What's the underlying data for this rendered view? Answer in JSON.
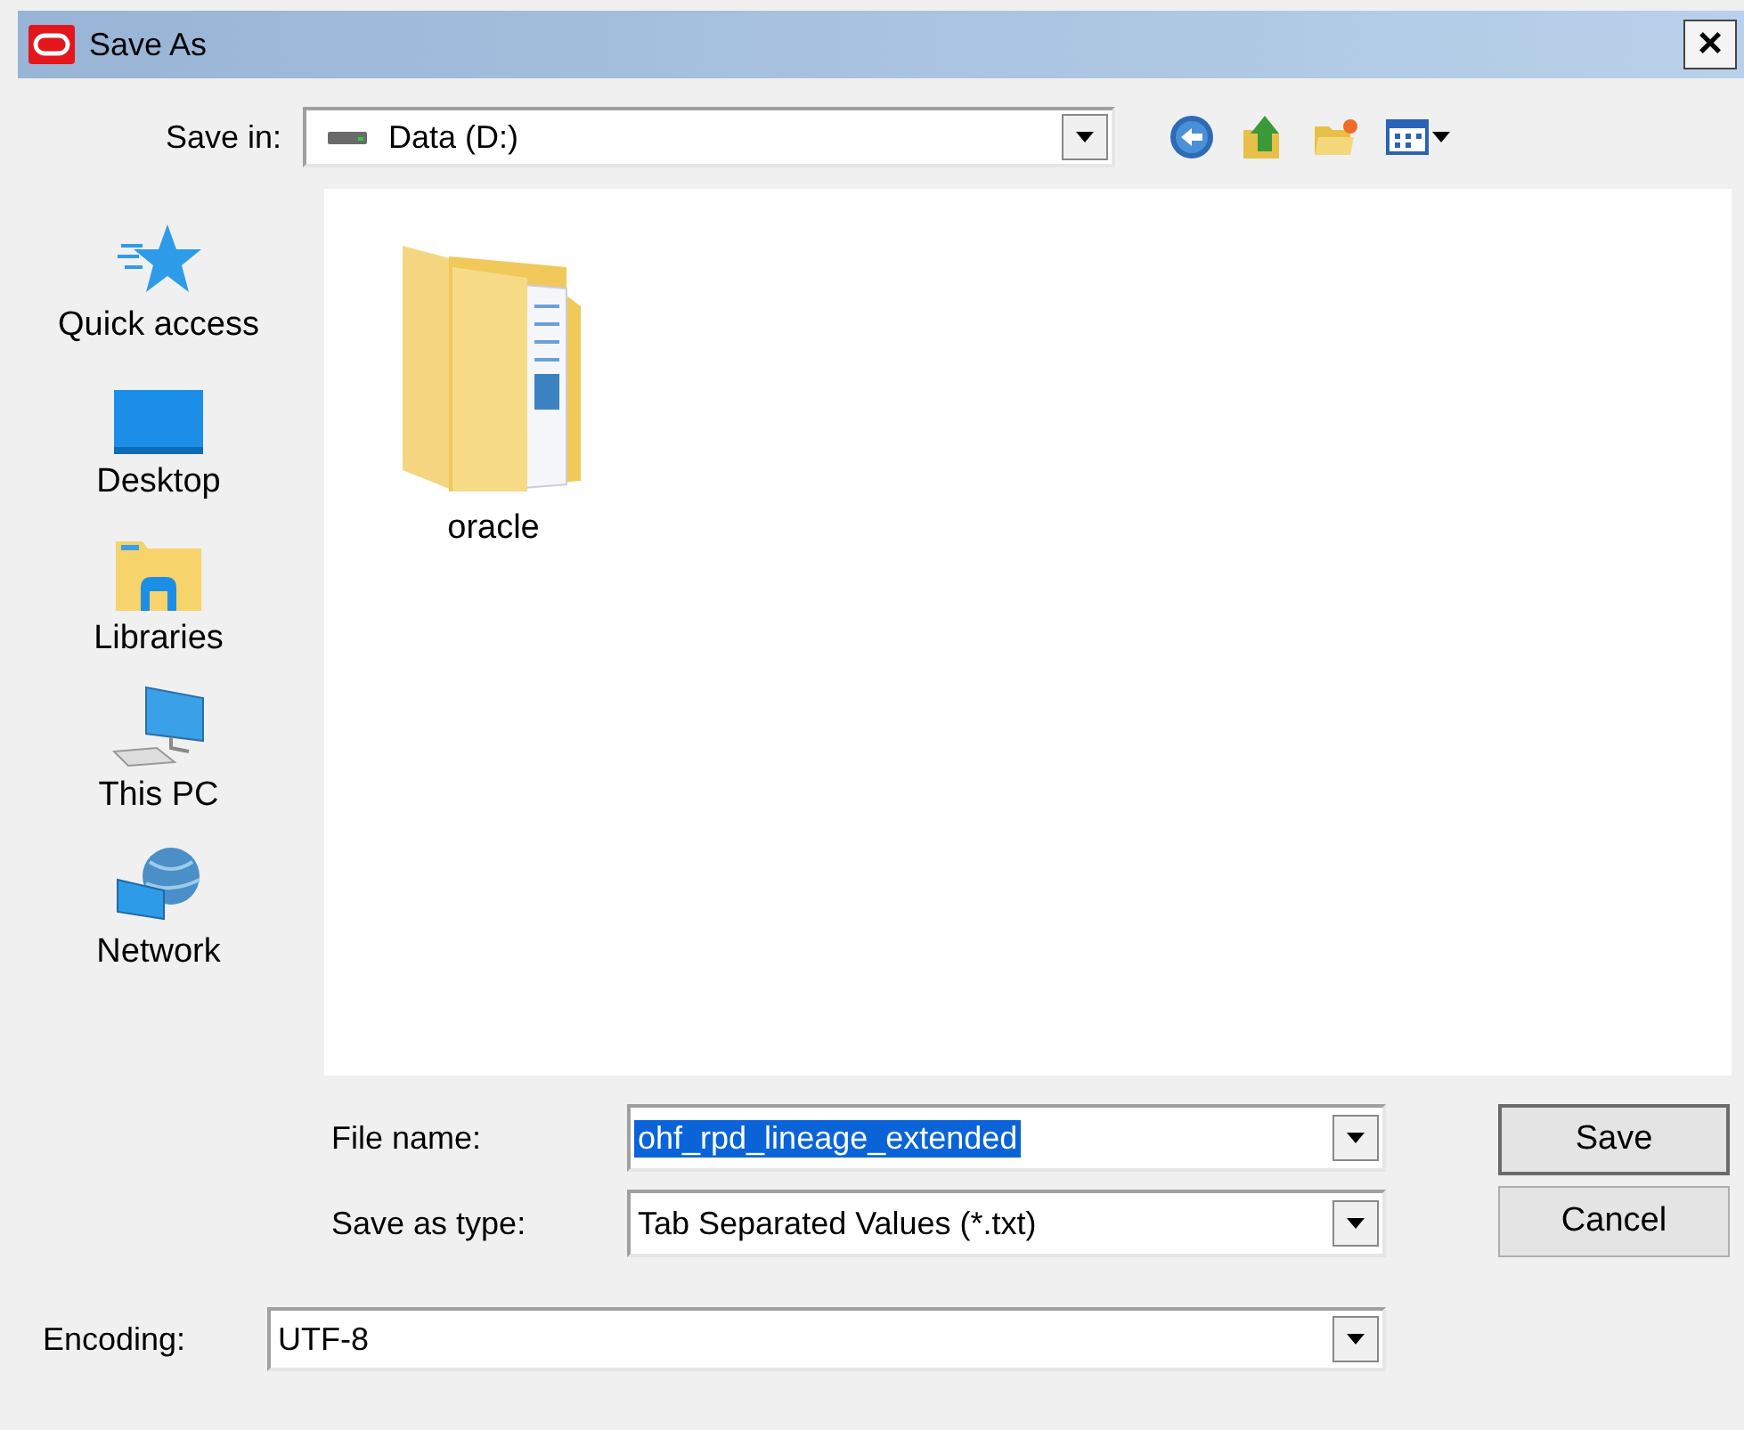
{
  "window": {
    "title": "Save As",
    "close": "×"
  },
  "save_in": {
    "label": "Save in:",
    "value": "Data (D:)"
  },
  "places": [
    {
      "label": "Quick access",
      "kind": "star"
    },
    {
      "label": "Desktop",
      "kind": "desktop"
    },
    {
      "label": "Libraries",
      "kind": "libraries"
    },
    {
      "label": "This PC",
      "kind": "pc"
    },
    {
      "label": "Network",
      "kind": "network"
    }
  ],
  "files": [
    {
      "name": "oracle"
    }
  ],
  "file_name": {
    "label": "File name:",
    "value": "ohf_rpd_lineage_extended",
    "text_selected": true
  },
  "save_as_type": {
    "label": "Save as type:",
    "value": "Tab Separated Values (*.txt)"
  },
  "encoding": {
    "label": "Encoding:",
    "value": "UTF-8"
  },
  "buttons": [
    {
      "label": "Save",
      "default": true
    },
    {
      "label": "Cancel",
      "default": false
    }
  ]
}
